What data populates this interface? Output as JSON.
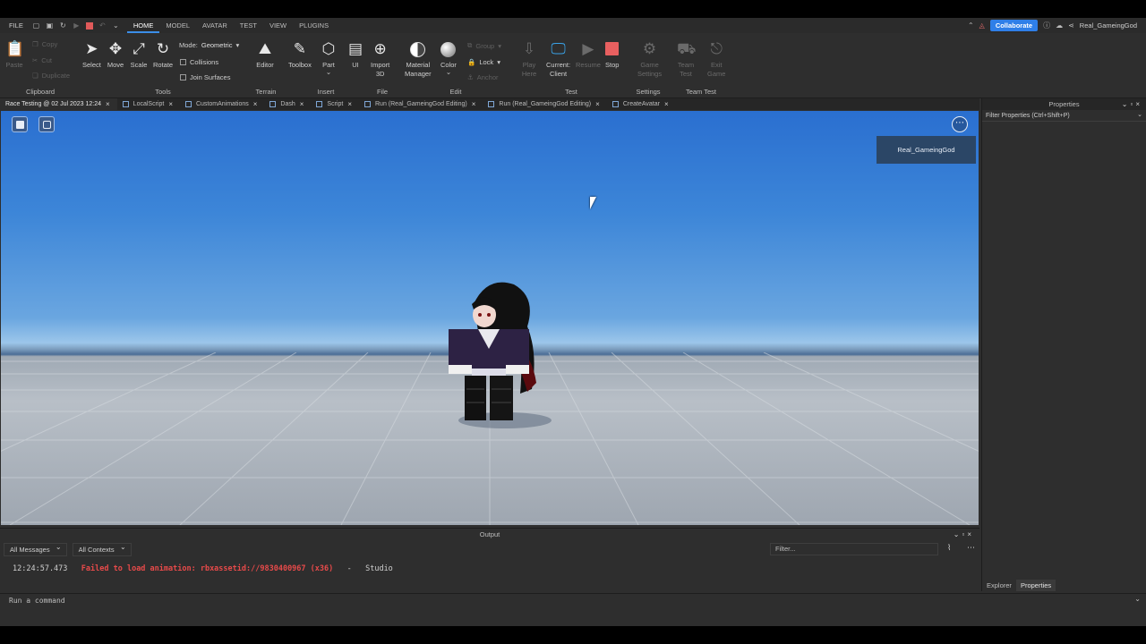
{
  "menubar": {
    "file": "FILE",
    "tabs": [
      "HOME",
      "MODEL",
      "AVATAR",
      "TEST",
      "VIEW",
      "PLUGINS"
    ],
    "collaborate": "Collaborate",
    "username": "Real_GameingGod"
  },
  "ribbon": {
    "clipboard": {
      "paste": "Paste",
      "copy": "Copy",
      "cut": "Cut",
      "duplicate": "Duplicate",
      "label": "Clipboard"
    },
    "tools": {
      "select": "Select",
      "move": "Move",
      "scale": "Scale",
      "rotate": "Rotate",
      "mode_label": "Mode:",
      "mode_value": "Geometric",
      "collisions": "Collisions",
      "join_surfaces": "Join Surfaces",
      "label": "Tools"
    },
    "terrain": {
      "editor": "Editor",
      "label": "Terrain"
    },
    "insert": {
      "toolbox": "Toolbox",
      "part": "Part",
      "ui": "UI",
      "label": "Insert"
    },
    "file": {
      "import_line1": "Import",
      "import_line2": "3D",
      "label": "File"
    },
    "edit": {
      "material_line1": "Material",
      "material_line2": "Manager",
      "color": "Color",
      "group": "Group",
      "lock": "Lock",
      "anchor": "Anchor",
      "label": "Edit"
    },
    "test": {
      "play_line1": "Play",
      "play_line2": "Here",
      "current_line1": "Current:",
      "current_line2": "Client",
      "resume": "Resume",
      "stop": "Stop",
      "label": "Test"
    },
    "settings": {
      "game_line1": "Game",
      "game_line2": "Settings",
      "label": "Settings"
    },
    "team_test": {
      "team_line1": "Team",
      "team_line2": "Test",
      "exit_line1": "Exit",
      "exit_line2": "Game",
      "label": "Team Test"
    }
  },
  "doctabs": [
    {
      "label": "Race Testing @ 02 Jul 2023 12:24"
    },
    {
      "label": "LocalScript"
    },
    {
      "label": "CustomAnimations"
    },
    {
      "label": "Dash"
    },
    {
      "label": "Script"
    },
    {
      "label": "Run (Real_GameingGod Editing)"
    },
    {
      "label": "Run (Real_GameingGod Editing)"
    },
    {
      "label": "CreateAvatar"
    }
  ],
  "viewport": {
    "player_name": "Real_GameingGod"
  },
  "output": {
    "title": "Output",
    "messages_filter": "All Messages",
    "contexts_filter": "All Contexts",
    "filter_placeholder": "Filter...",
    "log_time": "12:24:57.473",
    "log_message": "Failed to load animation: rbxassetid://9830400967 (x36)",
    "log_sep": "-",
    "log_source": "Studio"
  },
  "properties": {
    "title": "Properties",
    "filter": "Filter Properties (Ctrl+Shift+P)",
    "tab_explorer": "Explorer",
    "tab_properties": "Properties"
  },
  "command": {
    "placeholder": "Run a command"
  },
  "colors": {
    "accent": "#2f7fe8",
    "error": "#e84a4a",
    "stop": "#e86060"
  }
}
